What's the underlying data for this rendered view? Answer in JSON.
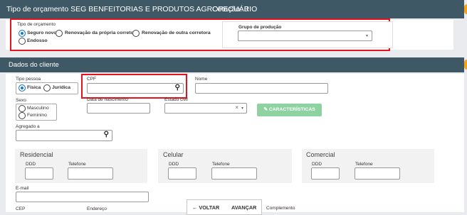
{
  "header": {
    "title": "Tipo de orçamento SEG BENFEITORIAS E PRODUTOS AGROPECUÁRIO",
    "cotacao": "Cotação: 0"
  },
  "tipo_orcamento": {
    "label": "Tipo de orçamento",
    "options": [
      "Seguro novo",
      "Renovação da própria corretora",
      "Renovação de outra corretora",
      "Endosso"
    ],
    "selected": "Seguro novo"
  },
  "grupo_producao": {
    "label": "Grupo de produção",
    "value": ""
  },
  "dados_cliente": {
    "title": "Dados do cliente",
    "tipo_pessoa": {
      "label": "Tipo pessoa",
      "options": [
        "Física",
        "Jurídica"
      ],
      "selected": "Física"
    },
    "cpf": {
      "label": "CPF",
      "value": ""
    },
    "nome": {
      "label": "Nome",
      "value": ""
    },
    "sexo": {
      "label": "Sexo",
      "options": [
        "Masculino",
        "Feminino"
      ]
    },
    "data_nascimento": {
      "label": "Data de nascimento",
      "value": ""
    },
    "estado_civil": {
      "label": "Estado civil",
      "clear": "×",
      "value": ""
    },
    "caracteristicas_label": "CARACTERÍSTICAS",
    "agregado": {
      "label": "Agregado a",
      "value": ""
    }
  },
  "telefones": [
    {
      "title": "Residencial",
      "ddd_label": "DDD",
      "tel_label": "Telefone"
    },
    {
      "title": "Celular",
      "ddd_label": "DDD",
      "tel_label": "Telefone"
    },
    {
      "title": "Comercial",
      "ddd_label": "DDD",
      "tel_label": "Telefone"
    }
  ],
  "email": {
    "label": "E-mail",
    "value": ""
  },
  "endereco": {
    "cep_label": "CEP",
    "endereco_label": "Endereço",
    "complemento_label": "Complemento"
  },
  "nav": {
    "voltar": "← VOLTAR",
    "avancar": "AVANÇAR"
  },
  "icons": {
    "search": "search-icon",
    "caret": "caret-down-icon",
    "edit": "edit-icon"
  },
  "colors": {
    "header": "#3f5865",
    "accent": "#1976c7",
    "highlight": "#e5121f",
    "green_button": "#8fd2a2"
  }
}
